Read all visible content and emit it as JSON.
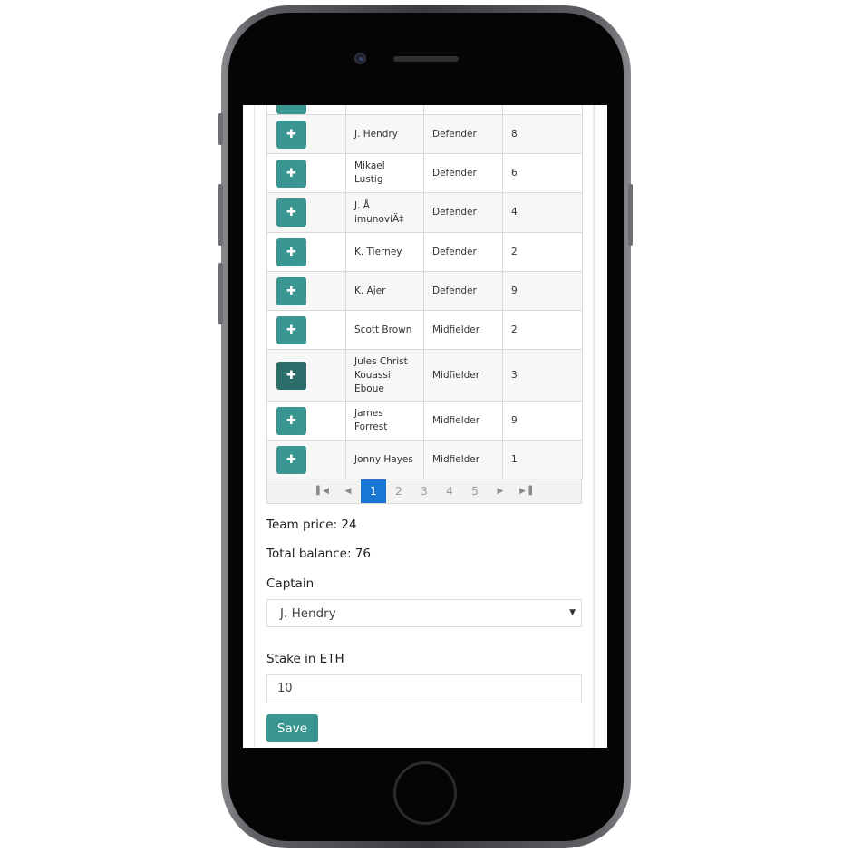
{
  "players": [
    {
      "name": "",
      "position": "",
      "price": "",
      "active": false
    },
    {
      "name": "J. Hendry",
      "position": "Defender",
      "price": "8",
      "active": false
    },
    {
      "name": "Mikael Lustig",
      "position": "Defender",
      "price": "6",
      "active": false
    },
    {
      "name": "J. Å imunoviÄ‡",
      "position": "Defender",
      "price": "4",
      "active": false
    },
    {
      "name": "K. Tierney",
      "position": "Defender",
      "price": "2",
      "active": false
    },
    {
      "name": "K. Ajer",
      "position": "Defender",
      "price": "9",
      "active": false
    },
    {
      "name": "Scott Brown",
      "position": "Midfielder",
      "price": "2",
      "active": false
    },
    {
      "name": "Jules Christ Kouassi Eboue",
      "position": "Midfielder",
      "price": "3",
      "active": true
    },
    {
      "name": "James Forrest",
      "position": "Midfielder",
      "price": "9",
      "active": false
    },
    {
      "name": "Jonny Hayes",
      "position": "Midfielder",
      "price": "1",
      "active": false
    }
  ],
  "add_icon": "plus-icon",
  "pagination": {
    "first_icon": "first-page-icon",
    "prev_icon": "prev-page-icon",
    "next_icon": "next-page-icon",
    "last_icon": "last-page-icon",
    "pages": [
      "1",
      "2",
      "3",
      "4",
      "5"
    ],
    "current": "1"
  },
  "summary": {
    "team_price": "Team price: 24",
    "total_balance": "Total balance: 76"
  },
  "captain": {
    "label": "Captain",
    "selected": "J. Hendry"
  },
  "stake": {
    "label": "Stake in ETH",
    "value": "10"
  },
  "save_label": "Save",
  "colors": {
    "accent": "#3a9690",
    "accent_active": "#2b6d69",
    "pager_current": "#1976d2"
  }
}
